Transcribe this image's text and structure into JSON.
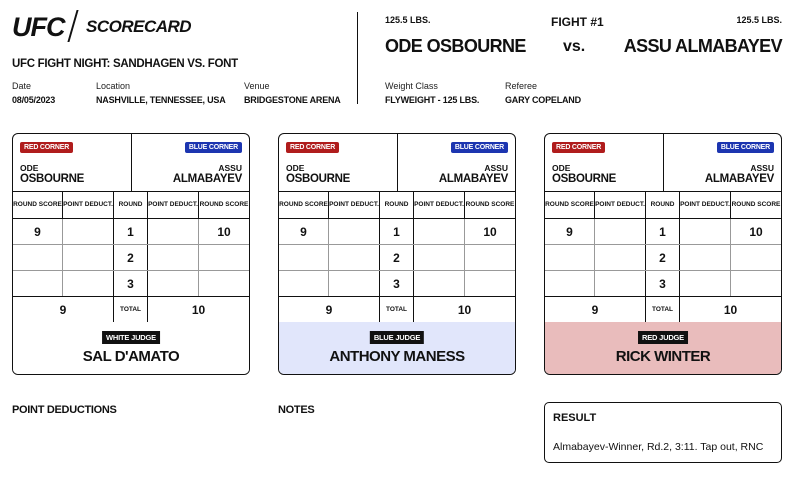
{
  "header": {
    "logo": "UFC",
    "title": "SCORECARD",
    "event": "UFC FIGHT NIGHT: SANDHAGEN VS. FONT",
    "date_label": "Date",
    "date": "08/05/2023",
    "location_label": "Location",
    "location": "NASHVILLE, TENNESSEE, USA",
    "venue_label": "Venue",
    "venue": "BRIDGESTONE ARENA"
  },
  "fight": {
    "red_weight": "125.5 LBS.",
    "blue_weight": "125.5 LBS.",
    "number": "FIGHT #1",
    "red_fighter": "ODE OSBOURNE",
    "vs": "vs.",
    "blue_fighter": "ASSU ALMABAYEV",
    "weight_class_label": "Weight Class",
    "weight_class": "FLYWEIGHT - 125 LBS.",
    "referee_label": "Referee",
    "referee": "GARY COPELAND"
  },
  "card_labels": {
    "red_corner": "RED CORNER",
    "blue_corner": "BLUE CORNER",
    "red_first": "ODE",
    "red_last": "OSBOURNE",
    "blue_first": "ASSU",
    "blue_last": "ALMABAYEV",
    "round_score": "ROUND SCORE",
    "point_deduct": "POINT DEDUCT.",
    "round": "ROUND",
    "total": "TOTAL"
  },
  "cards": [
    {
      "judge_label": "WHITE JUDGE",
      "judge_name": "SAL D'AMATO",
      "judge_color": "#ffffff",
      "rounds": [
        {
          "round": "1",
          "red_score": "9",
          "red_deduct": "",
          "blue_deduct": "",
          "blue_score": "10"
        },
        {
          "round": "2",
          "red_score": "",
          "red_deduct": "",
          "blue_deduct": "",
          "blue_score": ""
        },
        {
          "round": "3",
          "red_score": "",
          "red_deduct": "",
          "blue_deduct": "",
          "blue_score": ""
        }
      ],
      "red_total": "9",
      "blue_total": "10"
    },
    {
      "judge_label": "BLUE JUDGE",
      "judge_name": "ANTHONY MANESS",
      "judge_color": "#e1e6fb",
      "rounds": [
        {
          "round": "1",
          "red_score": "9",
          "red_deduct": "",
          "blue_deduct": "",
          "blue_score": "10"
        },
        {
          "round": "2",
          "red_score": "",
          "red_deduct": "",
          "blue_deduct": "",
          "blue_score": ""
        },
        {
          "round": "3",
          "red_score": "",
          "red_deduct": "",
          "blue_deduct": "",
          "blue_score": ""
        }
      ],
      "red_total": "9",
      "blue_total": "10"
    },
    {
      "judge_label": "RED JUDGE",
      "judge_name": "RICK WINTER",
      "judge_color": "#e9bcbc",
      "rounds": [
        {
          "round": "1",
          "red_score": "9",
          "red_deduct": "",
          "blue_deduct": "",
          "blue_score": "10"
        },
        {
          "round": "2",
          "red_score": "",
          "red_deduct": "",
          "blue_deduct": "",
          "blue_score": ""
        },
        {
          "round": "3",
          "red_score": "",
          "red_deduct": "",
          "blue_deduct": "",
          "blue_score": ""
        }
      ],
      "red_total": "9",
      "blue_total": "10"
    }
  ],
  "footer": {
    "point_deductions_title": "POINT DEDUCTIONS",
    "notes_title": "NOTES",
    "result_title": "RESULT",
    "result_text": "Almabayev-Winner, Rd.2, 3:11. Tap out, RNC"
  }
}
